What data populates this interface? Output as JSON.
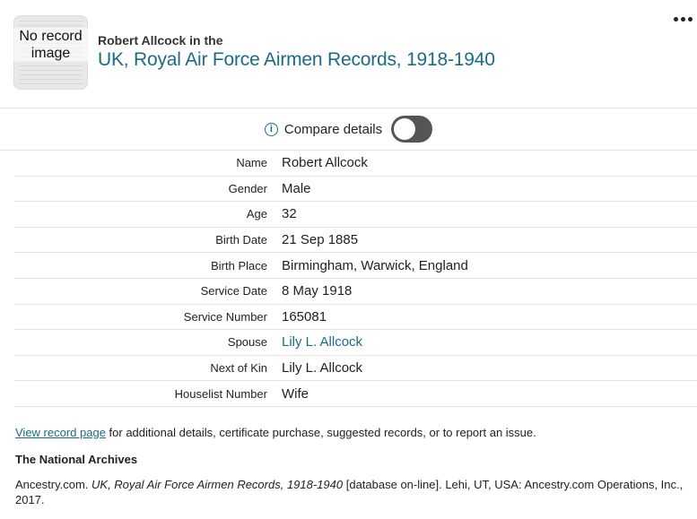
{
  "header": {
    "thumbnail_text": "No record image",
    "subtitle": "Robert Allcock in the",
    "title": "UK, Royal Air Force Airmen Records, 1918-1940"
  },
  "compare": {
    "info_icon": "info-icon",
    "label": "Compare details",
    "toggle_on": false
  },
  "details": [
    {
      "label": "Name",
      "value": "Robert Allcock",
      "link": false
    },
    {
      "label": "Gender",
      "value": "Male",
      "link": false
    },
    {
      "label": "Age",
      "value": "32",
      "link": false
    },
    {
      "label": "Birth Date",
      "value": "21 Sep 1885",
      "link": false
    },
    {
      "label": "Birth Place",
      "value": "Birmingham, Warwick, England",
      "link": false
    },
    {
      "label": "Service Date",
      "value": "8 May 1918",
      "link": false
    },
    {
      "label": "Service Number",
      "value": "165081",
      "link": false
    },
    {
      "label": "Spouse",
      "value": "Lily L. Allcock",
      "link": true
    },
    {
      "label": "Next of Kin",
      "value": "Lily L. Allcock",
      "link": false
    },
    {
      "label": "Houselist Number",
      "value": "Wife",
      "link": false
    }
  ],
  "footer": {
    "view_link": "View record page",
    "view_rest": " for additional details, certificate purchase, suggested records, or to report an issue.",
    "source_heading": "The National Archives",
    "citation_prefix": "Ancestry.com. ",
    "citation_title": "UK, Royal Air Force Airmen Records, 1918-1940",
    "citation_rest": " [database on-line]. Lehi, UT, USA: Ancestry.com Operations, Inc., 2017."
  },
  "colors": {
    "accent": "#1b6b86",
    "toggle_off": "#555555",
    "divider": "#e2e2e2"
  }
}
